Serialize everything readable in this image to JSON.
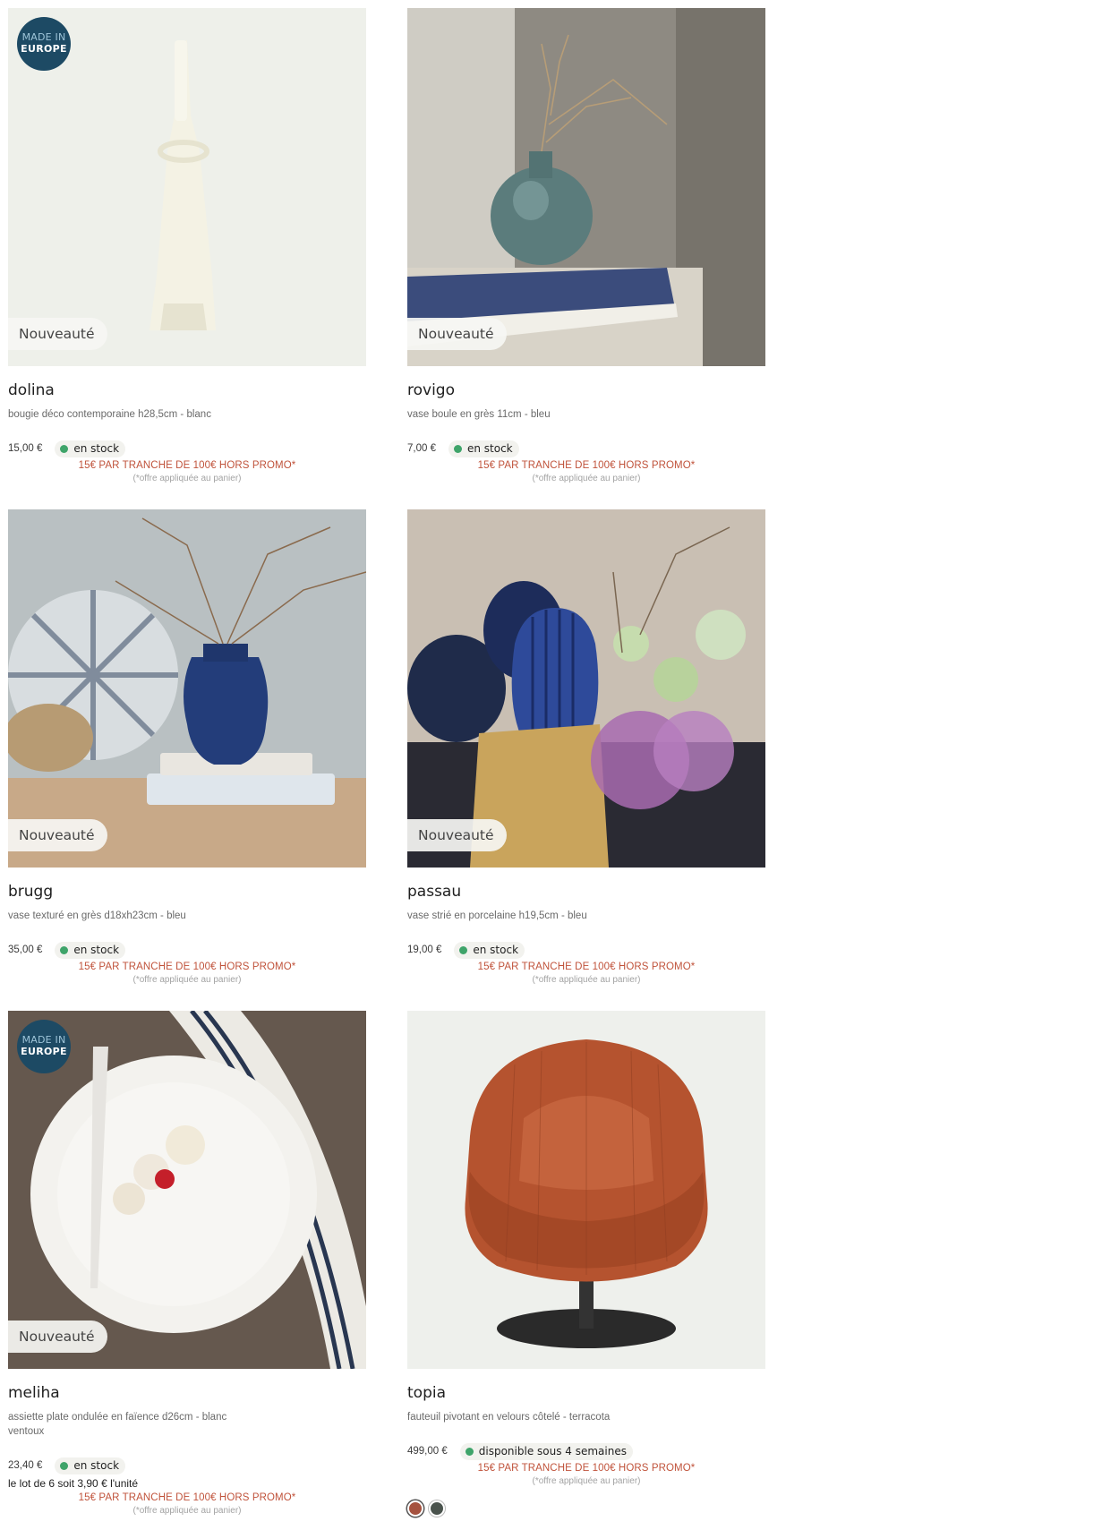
{
  "badges": {
    "new": "Nouveauté",
    "europe_line1": "MADE IN",
    "europe_line2": "EUROPE"
  },
  "promo": {
    "text": "15€ PAR TRANCHE DE 100€ HORS PROMO*",
    "note": "(*offre appliquée au panier)"
  },
  "products": [
    {
      "name": "dolina",
      "desc": "bougie déco contemporaine h28,5cm - blanc",
      "price": "15,00 €",
      "stock": "en stock"
    },
    {
      "name": "rovigo",
      "desc": "vase boule en grès 11cm - bleu",
      "price": "7,00 €",
      "stock": "en stock"
    },
    {
      "name": "brugg",
      "desc": "vase texturé en grès d18xh23cm - bleu",
      "price": "35,00 €",
      "stock": "en stock"
    },
    {
      "name": "passau",
      "desc": "vase strié en porcelaine h19,5cm - bleu",
      "price": "19,00 €",
      "stock": "en stock"
    },
    {
      "name": "meliha",
      "desc": "assiette plate ondulée en faïence d26cm - blanc",
      "desc2": "ventoux",
      "price": "23,40 €",
      "stock": "en stock",
      "unit": "le lot de 6 soit 3,90 € l'unité"
    },
    {
      "name": "topia",
      "desc": "fauteuil pivotant en velours côtelé - terracota",
      "price": "499,00 €",
      "stock": "disponible sous 4 semaines",
      "swatches": [
        "#a5523f",
        "#4a534d"
      ]
    }
  ]
}
